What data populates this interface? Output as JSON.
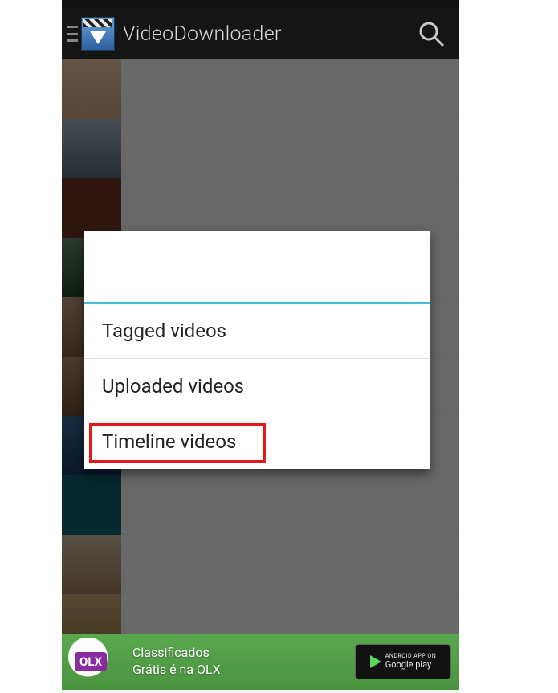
{
  "app": {
    "title": "VideoDownloader"
  },
  "dialog": {
    "options": [
      {
        "label": "Tagged videos"
      },
      {
        "label": "Uploaded videos"
      },
      {
        "label": "Timeline videos"
      }
    ],
    "highlighted_index": 2
  },
  "ad": {
    "brand": "OLX",
    "line1": "Classificados",
    "line2": "Grátis é na OLX",
    "store_small": "Android app on",
    "store_big": "Google play"
  }
}
